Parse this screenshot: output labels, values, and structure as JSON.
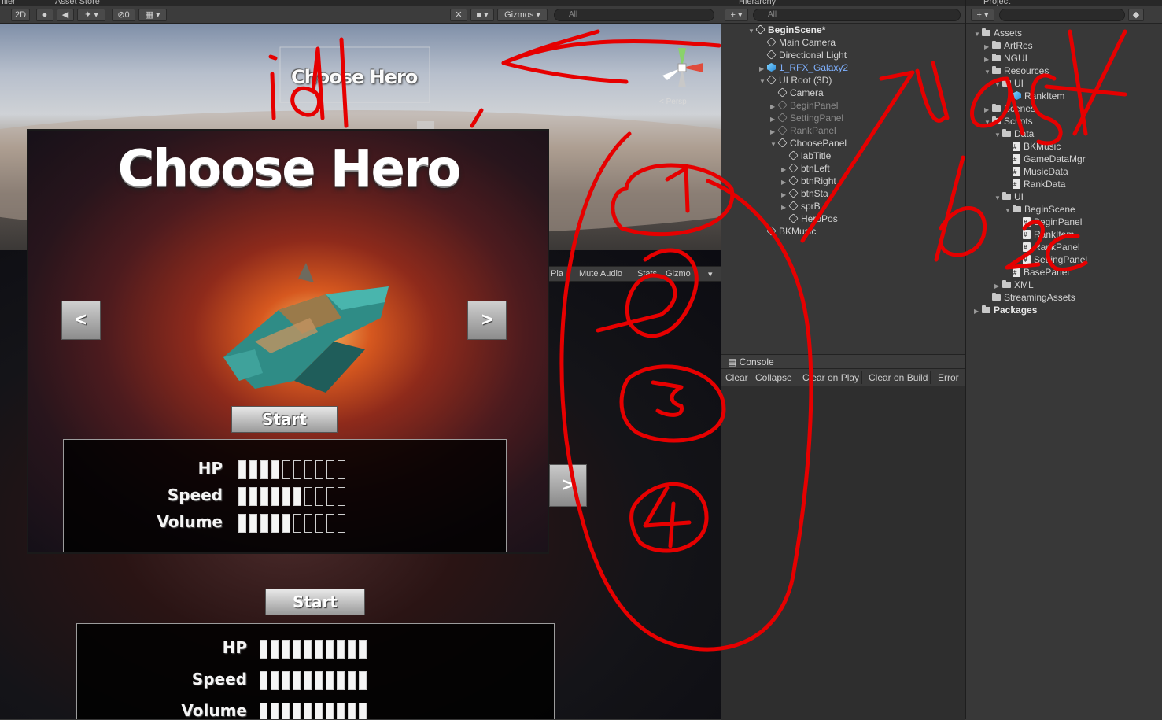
{
  "top_tabs": {
    "profiler": "filer",
    "asset_store": "Asset Store"
  },
  "scene_toolbar": {
    "mode_2d": "2D",
    "hidden_count": "0",
    "gizmos": "Gizmos",
    "search_placeholder": "All"
  },
  "scene_view": {
    "title_text": "Choose Hero",
    "persp_label": "< Persp"
  },
  "game_toolbar": {
    "play": "Pla",
    "mute_audio": "Mute Audio",
    "stats": "Stats",
    "gizmos": "Gizmo"
  },
  "game_view": {
    "title": "Choose Hero",
    "left_arrow": "<",
    "right_arrow": ">",
    "start_label": "Start",
    "stats": [
      {
        "label": "HP",
        "filled": 4,
        "total": 10
      },
      {
        "label": "Speed",
        "filled": 6,
        "total": 10
      },
      {
        "label": "Volume",
        "filled": 5,
        "total": 10
      }
    ],
    "lower_start_label": "Start",
    "lower_stats": [
      {
        "label": "HP",
        "filled": 10,
        "total": 10
      },
      {
        "label": "Speed",
        "filled": 10,
        "total": 10
      },
      {
        "label": "Volume",
        "filled": 10,
        "total": 10
      }
    ],
    "lower_right_arrow": ">"
  },
  "hierarchy": {
    "tab": "Hierarchy",
    "search_placeholder": "All",
    "items": [
      {
        "label": "BeginScene*",
        "type": "scene"
      },
      {
        "label": "Main Camera",
        "type": "go"
      },
      {
        "label": "Directional Light",
        "type": "go"
      },
      {
        "label": "1_RFX_Galaxy2",
        "type": "prefab"
      },
      {
        "label": "UI Root (3D)",
        "type": "go"
      },
      {
        "label": "Camera",
        "type": "go"
      },
      {
        "label": "BeginPanel",
        "type": "dim"
      },
      {
        "label": "SettingPanel",
        "type": "dim"
      },
      {
        "label": "RankPanel",
        "type": "dim"
      },
      {
        "label": "ChoosePanel",
        "type": "go"
      },
      {
        "label": "labTitle",
        "type": "go"
      },
      {
        "label": "btnLeft",
        "type": "go"
      },
      {
        "label": "btnRight",
        "type": "go"
      },
      {
        "label": "btnSta",
        "type": "go"
      },
      {
        "label": "sprB",
        "type": "go"
      },
      {
        "label": "HeroPos",
        "type": "go"
      },
      {
        "label": "BKMusic",
        "type": "go"
      }
    ]
  },
  "console": {
    "tab": "Console",
    "buttons": [
      "Clear",
      "Collapse",
      "Clear on Play",
      "Clear on Build",
      "Error P"
    ]
  },
  "project": {
    "tab": "Project",
    "items": [
      {
        "label": "Assets",
        "kind": "folder"
      },
      {
        "label": "ArtRes",
        "kind": "folder"
      },
      {
        "label": "NGUI",
        "kind": "folder"
      },
      {
        "label": "Resources",
        "kind": "folder"
      },
      {
        "label": "UI",
        "kind": "folder"
      },
      {
        "label": "RankItem",
        "kind": "prefab"
      },
      {
        "label": "Scenes",
        "kind": "folder"
      },
      {
        "label": "Scripts",
        "kind": "folder"
      },
      {
        "label": "Data",
        "kind": "folder"
      },
      {
        "label": "BKMusic",
        "kind": "script"
      },
      {
        "label": "GameDataMgr",
        "kind": "script"
      },
      {
        "label": "MusicData",
        "kind": "script"
      },
      {
        "label": "RankData",
        "kind": "script"
      },
      {
        "label": "UI",
        "kind": "folder"
      },
      {
        "label": "BeginScene",
        "kind": "folder"
      },
      {
        "label": "BeginPanel",
        "kind": "script"
      },
      {
        "label": "RankItem",
        "kind": "script"
      },
      {
        "label": "RankPanel",
        "kind": "script"
      },
      {
        "label": "SettingPanel",
        "kind": "script"
      },
      {
        "label": "BasePanel",
        "kind": "script"
      },
      {
        "label": "XML",
        "kind": "folder"
      },
      {
        "label": "StreamingAssets",
        "kind": "folder"
      },
      {
        "label": "Packages",
        "kind": "folder"
      }
    ]
  },
  "annotations": {
    "id": "id",
    "numbers": [
      "1",
      "2",
      "3",
      "4"
    ],
    "list": "list",
    "bpc": "b",
    "stroke_color": "#e60000"
  },
  "colors": {
    "accent_prefab": "#7fb1ff",
    "panel_bg": "#383838",
    "annotation": "#e60000"
  }
}
